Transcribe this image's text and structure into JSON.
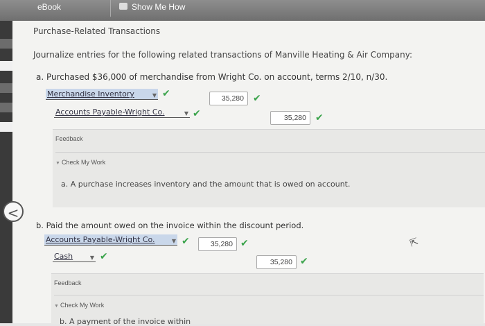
{
  "toolbar": {
    "ebook": "eBook",
    "show_me_how": "Show Me How"
  },
  "page": {
    "title": "Purchase-Related Transactions",
    "instructions": "Journalize entries for the following related transactions of Manville Heating & Air Company:"
  },
  "part_a": {
    "question": "a. Purchased $36,000 of merchandise from Wright Co. on account, terms 2/10, n/30.",
    "row1": {
      "account": "Merchandise Inventory",
      "debit": "35,280"
    },
    "row2": {
      "account": "Accounts Payable-Wright Co.",
      "credit": "35,280"
    },
    "feedback_label": "Feedback",
    "check_my_work": "Check My Work",
    "feedback_text": "a. A purchase increases inventory and the amount that is owed on account."
  },
  "part_b": {
    "question": "b. Paid the amount owed on the invoice within the discount period.",
    "row1": {
      "account": "Accounts Payable-Wright Co.",
      "debit": "35,280"
    },
    "row2": {
      "account": "Cash",
      "credit": "35,280"
    },
    "feedback_label": "Feedback",
    "check_my_work": "Check My Work",
    "feedback_text": "b. A payment of the invoice within"
  },
  "icons": {
    "check": "✔",
    "caret": "▼",
    "triangle": "▼",
    "back": "<",
    "cursor": "⇱"
  }
}
